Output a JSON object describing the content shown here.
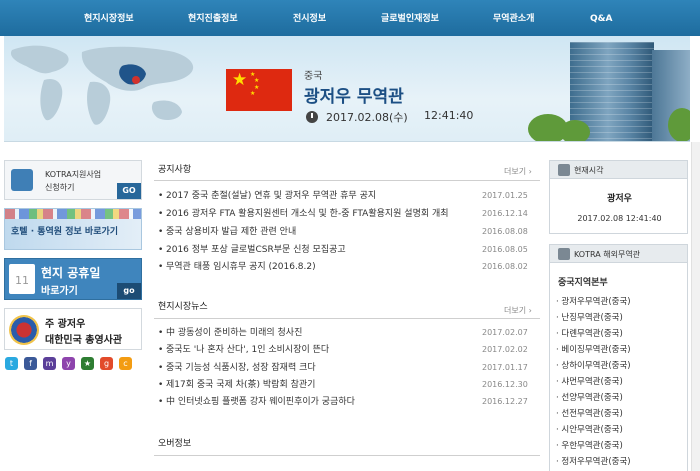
{
  "nav": {
    "items": [
      "현지시장정보",
      "현지진출정보",
      "전시정보",
      "글로벌인재정보",
      "무역관소개",
      "Q&A"
    ]
  },
  "banner": {
    "country": "중국",
    "office_name": "광저우 무역관",
    "date": "2017.02.08(수)",
    "time": "12:41:40"
  },
  "side_banners": {
    "kotra_support": {
      "line1": "KOTRA지원사업",
      "line2": "신청하기",
      "go": "GO"
    },
    "hotel": {
      "label": "호텔 · 통역원 정보 바로가기"
    },
    "holiday": {
      "line1": "현지 공휴일",
      "line2": "바로가기",
      "go": "go"
    },
    "consulate": {
      "line1": "주 광저우",
      "line2": "대한민국 총영사관"
    }
  },
  "social_icons": [
    "twitter-icon",
    "facebook-icon",
    "me2day-icon",
    "yozm-icon",
    "delicious-icon",
    "google-icon",
    "c-log-icon"
  ],
  "notice": {
    "title": "공지사항",
    "more": "더보기",
    "posts": [
      {
        "title": "2017 중국 춘절(설날) 연휴 및 광저우 무역관 휴무 공지",
        "date": "2017.01.25"
      },
      {
        "title": "2016 광저우 FTA 활용지원센터 개소식 및 한-중 FTA활용지원 설명회 개최",
        "date": "2016.12.14"
      },
      {
        "title": "중국 상용비자 발급 제한 관련 안내",
        "date": "2016.08.08"
      },
      {
        "title": "2016 정부 포상 글로벌CSR부문 신청 모집공고",
        "date": "2016.08.05"
      },
      {
        "title": "무역관 태풍 임시휴무 공지 (2016.8.2)",
        "date": "2016.08.02"
      }
    ]
  },
  "market_news": {
    "title": "현지시장뉴스",
    "more": "더보기",
    "posts": [
      {
        "title": "中 광동성이 준비하는 미래의 청사진",
        "date": "2017.02.07"
      },
      {
        "title": "중국도 '나 혼자 산다', 1인 소비시장이 뜬다",
        "date": "2017.02.02"
      },
      {
        "title": "중국 기능성 식품시장, 성장 잠재력 크다",
        "date": "2017.01.17"
      },
      {
        "title": "제17회 중국 국제 차(茶) 박람회 참관기",
        "date": "2016.12.30"
      },
      {
        "title": "中 인터넷쇼핑 플랫폼 강자 웨이핀후이가 궁금하다",
        "date": "2016.12.27"
      }
    ]
  },
  "overseas_info": {
    "title": "오버정보"
  },
  "current_time": {
    "header": "현재시각",
    "city": "광저우",
    "datetime": "2017.02.08 12:41:40"
  },
  "kotra_offices": {
    "header": "KOTRA 해외무역관",
    "region": "중국지역본부",
    "offices": [
      "광저우무역관(중국)",
      "난징무역관(중국)",
      "다롄무역관(중국)",
      "베이징무역관(중국)",
      "상하이무역관(중국)",
      "샤먼무역관(중국)",
      "선양무역관(중국)",
      "선전무역관(중국)",
      "시안무역관(중국)",
      "우한무역관(중국)",
      "정저우무역관(중국)"
    ]
  },
  "colors": {
    "nav_bg": "#2479ad",
    "title_blue": "#1c4f84",
    "china_red": "#de2910",
    "china_yellow": "#ffde00"
  }
}
